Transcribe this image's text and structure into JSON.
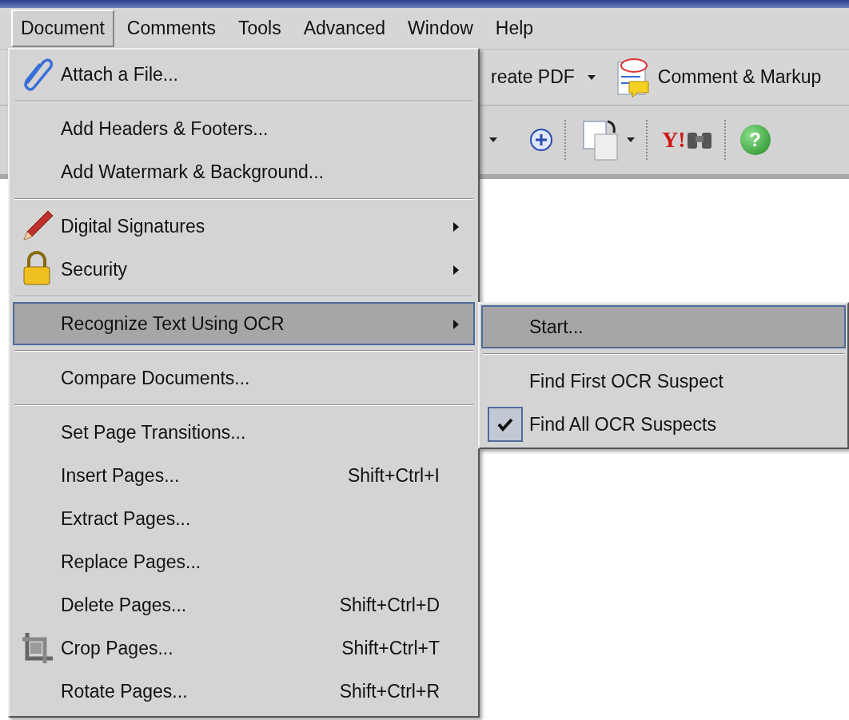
{
  "menu_bar": [
    {
      "label": "Document",
      "selected": true
    },
    {
      "label": "Comments",
      "selected": false
    },
    {
      "label": "Tools",
      "selected": false
    },
    {
      "label": "Advanced",
      "selected": false
    },
    {
      "label": "Window",
      "selected": false
    },
    {
      "label": "Help",
      "selected": false
    }
  ],
  "toolbar": {
    "create_pdf": "reate PDF",
    "comment_markup": "Comment & Markup",
    "search_logo": "Y!",
    "help_glyph": "?"
  },
  "document_menu": [
    {
      "kind": "item",
      "label": "Attach a File...",
      "selected": false,
      "submenu": false
    },
    {
      "kind": "separator"
    },
    {
      "kind": "item",
      "label": "Add Headers & Footers...",
      "selected": false,
      "submenu": false
    },
    {
      "kind": "item",
      "label": "Add Watermark & Background...",
      "selected": false,
      "submenu": false
    },
    {
      "kind": "separator"
    },
    {
      "kind": "item",
      "label": "Digital Signatures",
      "selected": false,
      "submenu": true
    },
    {
      "kind": "item",
      "label": "Security",
      "selected": false,
      "submenu": true
    },
    {
      "kind": "separator"
    },
    {
      "kind": "item",
      "label": "Recognize Text Using OCR",
      "selected": true,
      "submenu": true
    },
    {
      "kind": "separator"
    },
    {
      "kind": "item",
      "label": "Compare Documents...",
      "selected": false,
      "submenu": false
    },
    {
      "kind": "separator"
    },
    {
      "kind": "item",
      "label": "Set Page Transitions...",
      "selected": false,
      "submenu": false
    },
    {
      "kind": "item",
      "label": "Insert Pages...",
      "shortcut": "Shift+Ctrl+I",
      "selected": false,
      "submenu": false
    },
    {
      "kind": "item",
      "label": "Extract Pages...",
      "selected": false,
      "submenu": false
    },
    {
      "kind": "item",
      "label": "Replace Pages...",
      "selected": false,
      "submenu": false
    },
    {
      "kind": "item",
      "label": "Delete Pages...",
      "shortcut": "Shift+Ctrl+D",
      "selected": false,
      "submenu": false
    },
    {
      "kind": "item",
      "label": "Crop Pages...",
      "shortcut": "Shift+Ctrl+T",
      "selected": false,
      "submenu": false
    },
    {
      "kind": "item",
      "label": "Rotate Pages...",
      "shortcut": "Shift+Ctrl+R",
      "selected": false,
      "submenu": false
    }
  ],
  "ocr_submenu": [
    {
      "kind": "item",
      "label": "Start...",
      "selected": true,
      "checked": false
    },
    {
      "kind": "separator"
    },
    {
      "kind": "item",
      "label": "Find First OCR Suspect",
      "selected": false,
      "checked": false
    },
    {
      "kind": "item",
      "label": "Find All OCR Suspects",
      "selected": false,
      "checked": true
    }
  ]
}
